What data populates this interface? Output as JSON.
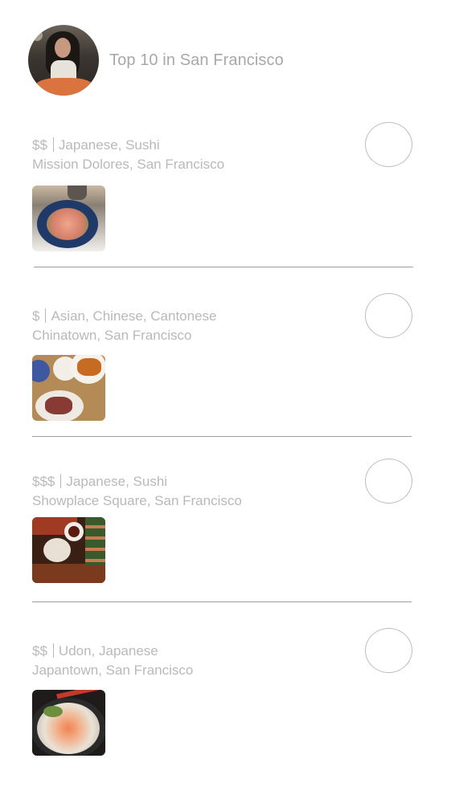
{
  "header": {
    "title": "Top 10 in San Francisco"
  },
  "restaurants": [
    {
      "price": "$$",
      "cuisines": "Japanese, Sushi",
      "location": "Mission Dolores, San Francisco"
    },
    {
      "price": "$",
      "cuisines": "Asian, Chinese, Cantonese",
      "location": "Chinatown, San Francisco"
    },
    {
      "price": "$$$",
      "cuisines": "Japanese, Sushi",
      "location": "Showplace Square, San Francisco"
    },
    {
      "price": "$$",
      "cuisines": "Udon, Japanese",
      "location": "Japantown, San Francisco"
    }
  ],
  "colors": {
    "text": "#b9b9b9",
    "divider": "#9e9e9e",
    "circle": "#bdbdbd"
  }
}
